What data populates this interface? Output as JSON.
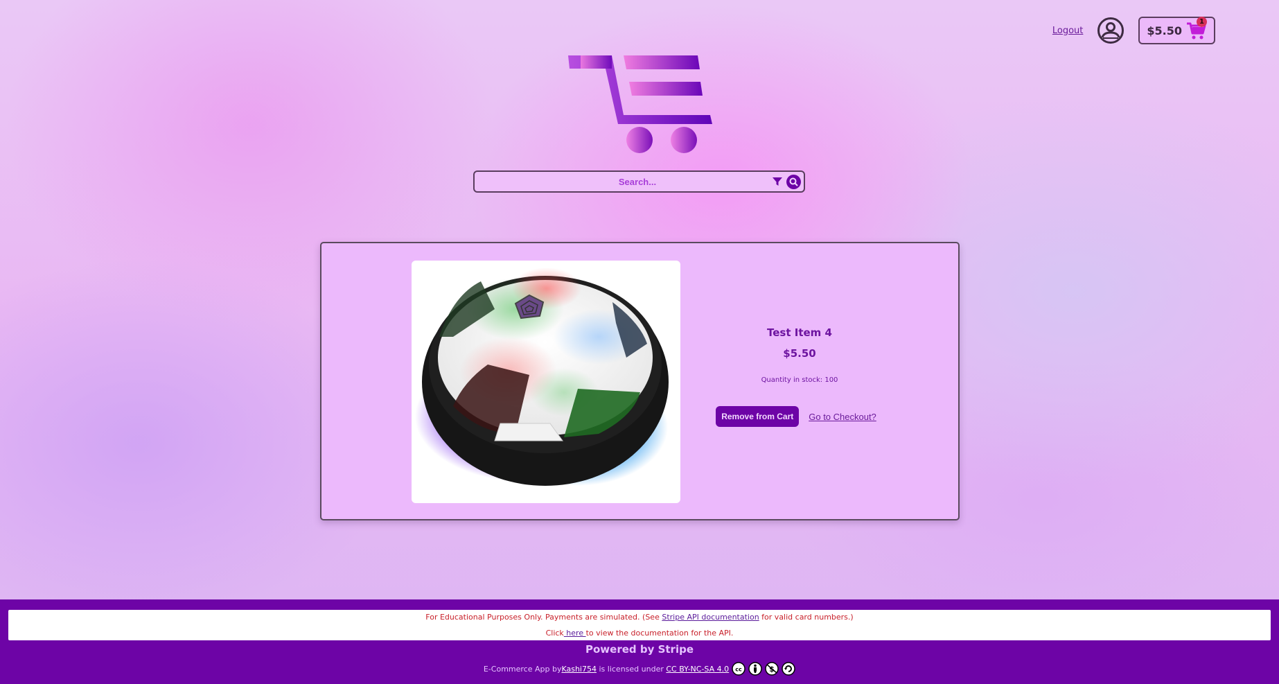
{
  "header": {
    "logout_label": "Logout",
    "account_icon": "user-circle-icon",
    "cart": {
      "total": "$5.50",
      "item_count": "1",
      "icon": "shopping-cart-icon"
    }
  },
  "logo": {
    "icon": "cart-logo-icon"
  },
  "search": {
    "placeholder": "Search...",
    "value": "",
    "filter_icon": "filter-icon",
    "search_icon": "search-icon"
  },
  "product": {
    "name": "Test Item 4",
    "price": "$5.50",
    "stock_label": "Quantity in stock: 100",
    "image_alt": "Hover soccer ball with LED lights",
    "remove_label": "Remove from Cart",
    "checkout_label": "Go to Checkout?"
  },
  "footer": {
    "notice_line1_pre": "For Educational Purposes Only. Payments are simulated. (See ",
    "notice_line1_link": "Stripe API documentation",
    "notice_line1_post": " for valid card numbers.)",
    "notice_line2_pre": "Click",
    "notice_line2_link": " here ",
    "notice_line2_post": "to view the documentation for the API.",
    "powered_by": "Powered by Stripe",
    "license_pre": "E-Commerce App by",
    "license_author": " Kashi754",
    "license_mid": " is licensed under ",
    "license_link": "CC BY-NC-SA 4.0 ",
    "license_icons": [
      "cc-icon",
      "by-icon",
      "nc-icon",
      "sa-icon"
    ]
  },
  "colors": {
    "accent": "#6d04a6",
    "card_bg": "#ecb9fc",
    "notice_text": "#c8202a",
    "badge": "#d8305a"
  }
}
